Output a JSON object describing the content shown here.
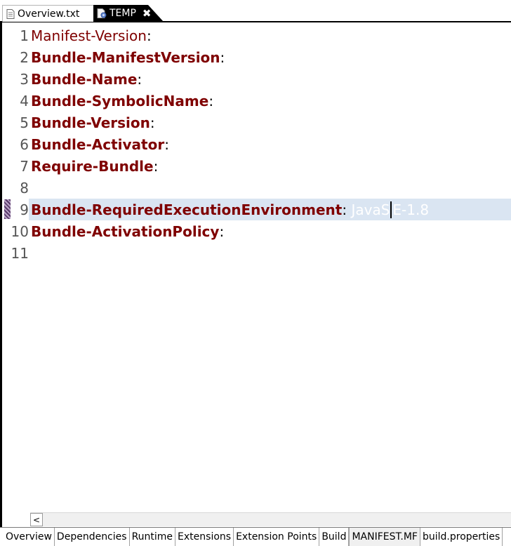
{
  "editor_tabs": [
    {
      "label": "Overview.txt",
      "icon": "text-file-icon",
      "active": false
    },
    {
      "label": "TEMP",
      "icon": "manifest-file-icon",
      "active": true,
      "close_icon": "close-icon"
    }
  ],
  "close_glyph": "✖",
  "lines": [
    {
      "number": "1",
      "key": "Manifest-Version",
      "style": "plain",
      "colon": ":",
      "value": ""
    },
    {
      "number": "2",
      "key": "Bundle-ManifestVersion",
      "style": "bold",
      "colon": ":",
      "value": ""
    },
    {
      "number": "3",
      "key": "Bundle-Name",
      "style": "bold",
      "colon": ":",
      "value": ""
    },
    {
      "number": "4",
      "key": "Bundle-SymbolicName",
      "style": "bold",
      "colon": ":",
      "value": ""
    },
    {
      "number": "5",
      "key": "Bundle-Version",
      "style": "bold",
      "colon": ":",
      "value": ""
    },
    {
      "number": "6",
      "key": "Bundle-Activator",
      "style": "bold",
      "colon": ":",
      "value": ""
    },
    {
      "number": "7",
      "key": "Require-Bundle",
      "style": "bold",
      "colon": ":",
      "value": ""
    },
    {
      "number": "8",
      "key": "",
      "style": "plain",
      "colon": "",
      "value": ""
    },
    {
      "number": "9",
      "key": "Bundle-RequiredExecutionEnvironment",
      "style": "bold",
      "colon": ":",
      "value_before_caret": " JavaS",
      "value_after_caret": "E-1.8",
      "highlight": true
    },
    {
      "number": "10",
      "key": "Bundle-ActivationPolicy",
      "style": "bold",
      "colon": ":",
      "value": ""
    },
    {
      "number": "11",
      "key": "",
      "style": "plain",
      "colon": "",
      "value": ""
    }
  ],
  "scrollbar": {
    "left_arrow": "<"
  },
  "page_tabs": [
    {
      "label": "Overview",
      "selected": false
    },
    {
      "label": "Dependencies",
      "selected": false
    },
    {
      "label": "Runtime",
      "selected": false
    },
    {
      "label": "Extensions",
      "selected": false
    },
    {
      "label": "Extension Points",
      "selected": false
    },
    {
      "label": "Build",
      "selected": false
    },
    {
      "label": "MANIFEST.MF",
      "selected": true
    },
    {
      "label": "build.properties",
      "selected": false
    }
  ],
  "colors": {
    "keyword": "#7f0000",
    "line_number": "#555555",
    "current_line_highlight": "#dae5f2",
    "active_tab_bg": "#000000",
    "value_text": "#ffffff"
  }
}
